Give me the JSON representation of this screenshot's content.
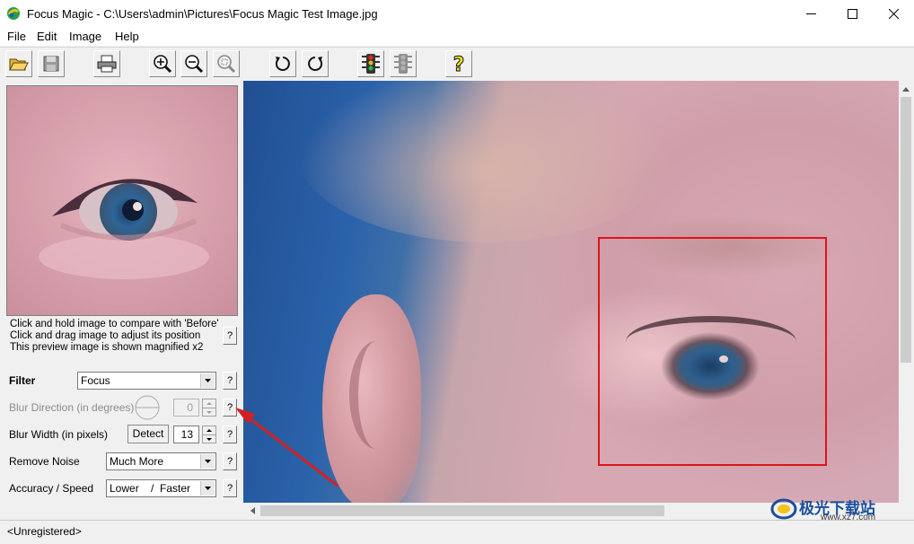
{
  "window": {
    "title": "Focus Magic - C:\\Users\\admin\\Pictures\\Focus Magic Test Image.jpg"
  },
  "menu": [
    "File",
    "Edit",
    "Image",
    "Help"
  ],
  "toolbar": {
    "buttons": [
      "open-icon",
      "save-icon",
      "print-icon",
      "zoom-in-icon",
      "zoom-out-icon",
      "zoom-fit-icon",
      "undo-icon",
      "redo-icon",
      "traffic-light-icon",
      "traffic-light-disabled-icon",
      "help-icon"
    ]
  },
  "preview": {
    "hint_lines": [
      "Click and hold image to compare with 'Before'",
      "Click and drag image to adjust its position",
      "This preview image is shown magnified x2"
    ],
    "help": "?"
  },
  "settings": {
    "filter": {
      "label": "Filter",
      "value": "Focus"
    },
    "blur_direction": {
      "label": "Blur Direction (in degrees)",
      "value": "0"
    },
    "blur_width": {
      "label": "Blur Width (in pixels)",
      "detect_label": "Detect",
      "value": "13"
    },
    "remove_noise": {
      "label": "Remove Noise",
      "value": "Much More"
    },
    "accuracy_speed": {
      "label": "Accuracy / Speed",
      "value": "Lower    /  Faster"
    },
    "help": "?"
  },
  "status": {
    "text": "<Unregistered>"
  },
  "watermark": {
    "name": "极光下载站",
    "url": "www.xz7.com"
  },
  "colors": {
    "selection_box": "#e0121a",
    "annotation_arrow": "#d42020"
  }
}
